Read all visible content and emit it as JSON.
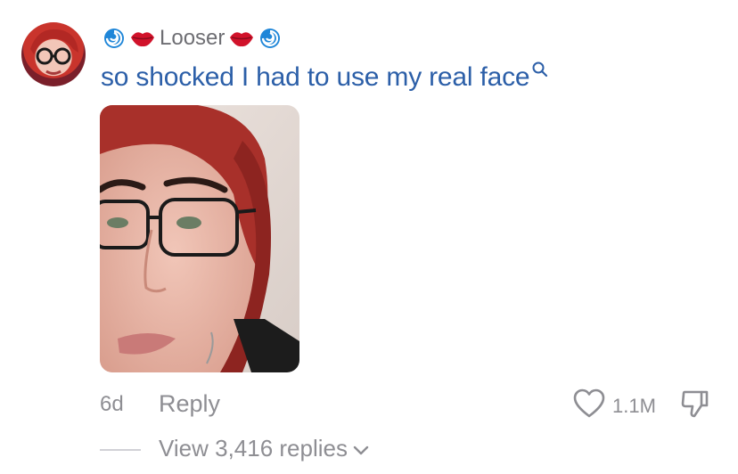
{
  "comment": {
    "username": "Looser",
    "username_emoji_left": [
      "cyclone",
      "lips"
    ],
    "username_emoji_right": [
      "lips",
      "cyclone"
    ],
    "text": "so shocked I had to use my real face",
    "age": "6d",
    "reply_label": "Reply",
    "like_count": "1.1M",
    "view_replies_label": "View 3,416 replies"
  },
  "colors": {
    "comment_link": "#2c5fa8",
    "secondary_text": "#8e8e93",
    "lips": "#d1122a",
    "cyclone": "#1f86d8"
  },
  "icons": {
    "avatar": "avatar",
    "search": "search-icon",
    "like": "heart-outline-icon",
    "dislike": "thumbs-down-outline-icon",
    "expand": "chevron-down-icon"
  }
}
